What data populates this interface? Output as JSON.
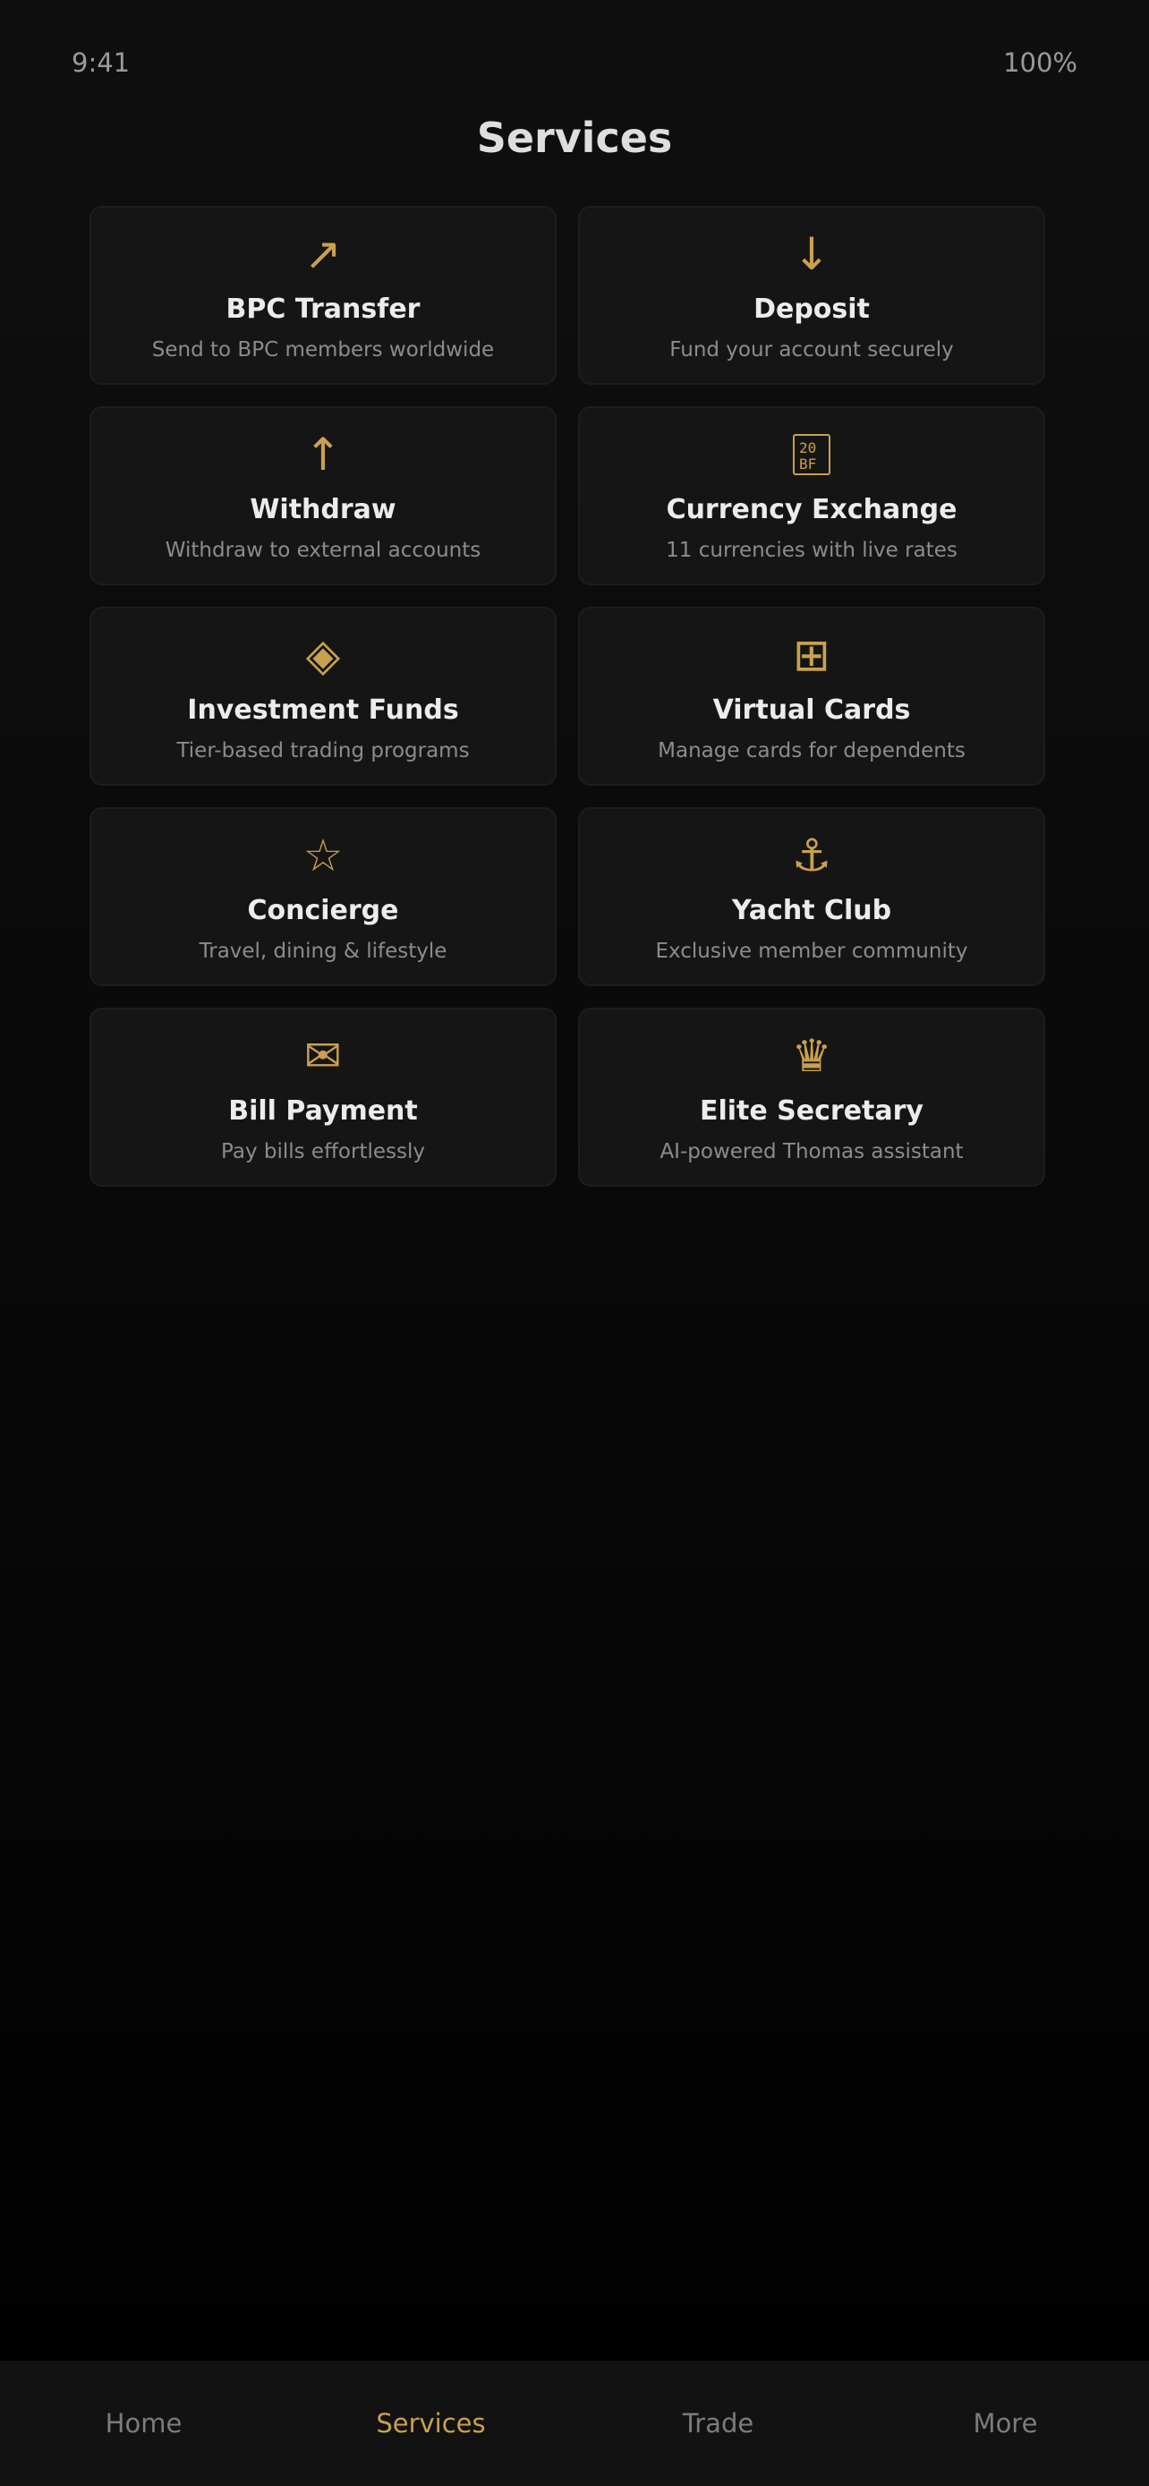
{
  "status_bar": {
    "time": "9:41",
    "battery": "100%"
  },
  "page": {
    "title": "Services"
  },
  "colors": {
    "accent": "#c9a04e",
    "background": "#0b0b0b",
    "card": "#151515",
    "muted_text": "#8c8c8c"
  },
  "services": [
    {
      "icon": "arrow-up-right-icon",
      "glyph": "↗",
      "title": "BPC Transfer",
      "subtitle": "Send to BPC members worldwide"
    },
    {
      "icon": "arrow-down-icon",
      "glyph": "↓",
      "title": "Deposit",
      "subtitle": "Fund your account securely"
    },
    {
      "icon": "arrow-up-icon",
      "glyph": "↑",
      "title": "Withdraw",
      "subtitle": "Withdraw to external accounts"
    },
    {
      "icon": "currency-exchange-icon",
      "glyph": "",
      "title": "Currency Exchange",
      "subtitle": "11 currencies with live rates"
    },
    {
      "icon": "diamond-icon",
      "glyph": "◈",
      "title": "Investment Funds",
      "subtitle": "Tier-based trading programs"
    },
    {
      "icon": "card-grid-icon",
      "glyph": "⊞",
      "title": "Virtual Cards",
      "subtitle": "Manage cards for dependents"
    },
    {
      "icon": "star-icon",
      "glyph": "☆",
      "title": "Concierge",
      "subtitle": "Travel, dining & lifestyle"
    },
    {
      "icon": "anchor-icon",
      "glyph": "⚓",
      "title": "Yacht Club",
      "subtitle": "Exclusive member community"
    },
    {
      "icon": "envelope-icon",
      "glyph": "✉",
      "title": "Bill Payment",
      "subtitle": "Pay bills effortlessly"
    },
    {
      "icon": "crown-icon",
      "glyph": "♛",
      "title": "Elite Secretary",
      "subtitle": "AI-powered Thomas assistant"
    }
  ],
  "bottom_nav": {
    "items": [
      {
        "label": "Home"
      },
      {
        "label": "Services",
        "active": true
      },
      {
        "label": "Trade"
      },
      {
        "label": "More"
      }
    ]
  }
}
